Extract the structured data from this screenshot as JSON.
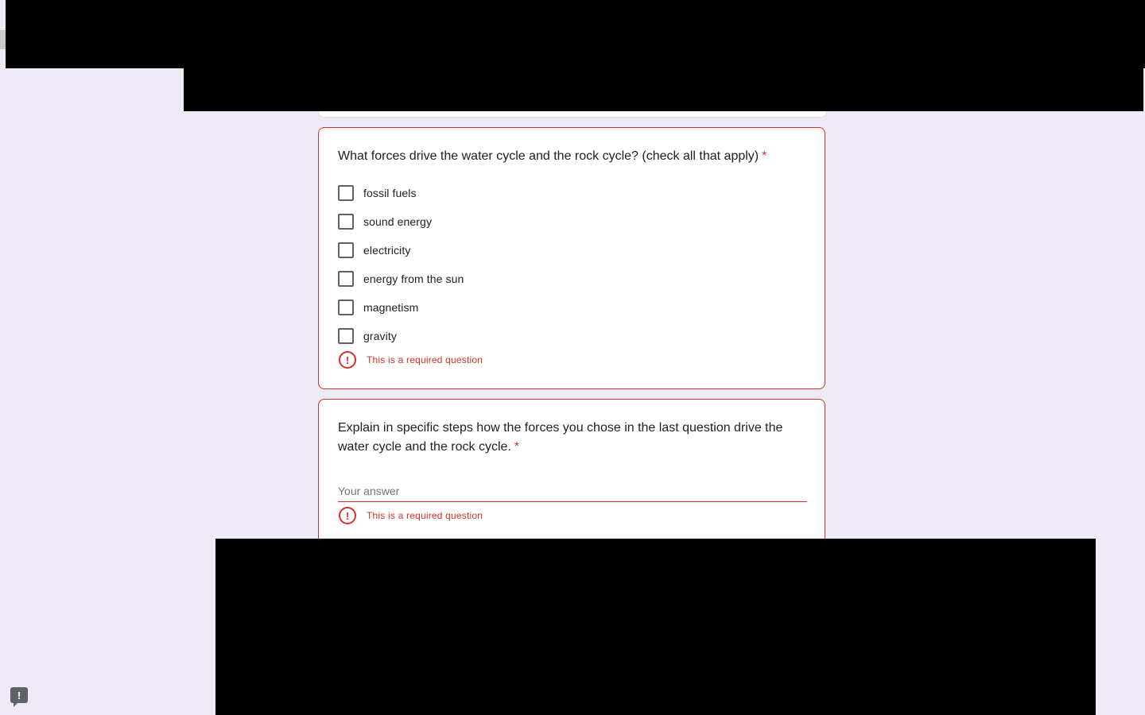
{
  "question1": {
    "title": "What forces drive the water cycle and the rock cycle? (check all that apply)",
    "required_mark": "*",
    "options": [
      {
        "label": "fossil fuels",
        "checked": false
      },
      {
        "label": "sound energy",
        "checked": false
      },
      {
        "label": "electricity",
        "checked": false
      },
      {
        "label": "energy from the sun",
        "checked": false
      },
      {
        "label": "magnetism",
        "checked": false
      },
      {
        "label": "gravity",
        "checked": false
      }
    ],
    "error_icon": "alert-circle-icon",
    "error": "This is a required question"
  },
  "question2": {
    "title": "Explain in specific steps how the forces you chose in the last question drive the water cycle and the rock cycle.",
    "required_mark": "*",
    "answer_placeholder": "Your answer",
    "answer_value": "",
    "error_icon": "alert-circle-icon",
    "error": "This is a required question"
  },
  "feedback": {
    "icon": "report-problem-icon",
    "glyph": "!"
  },
  "colors": {
    "background": "#efe9f8",
    "error": "#d93025",
    "text": "#202124"
  }
}
